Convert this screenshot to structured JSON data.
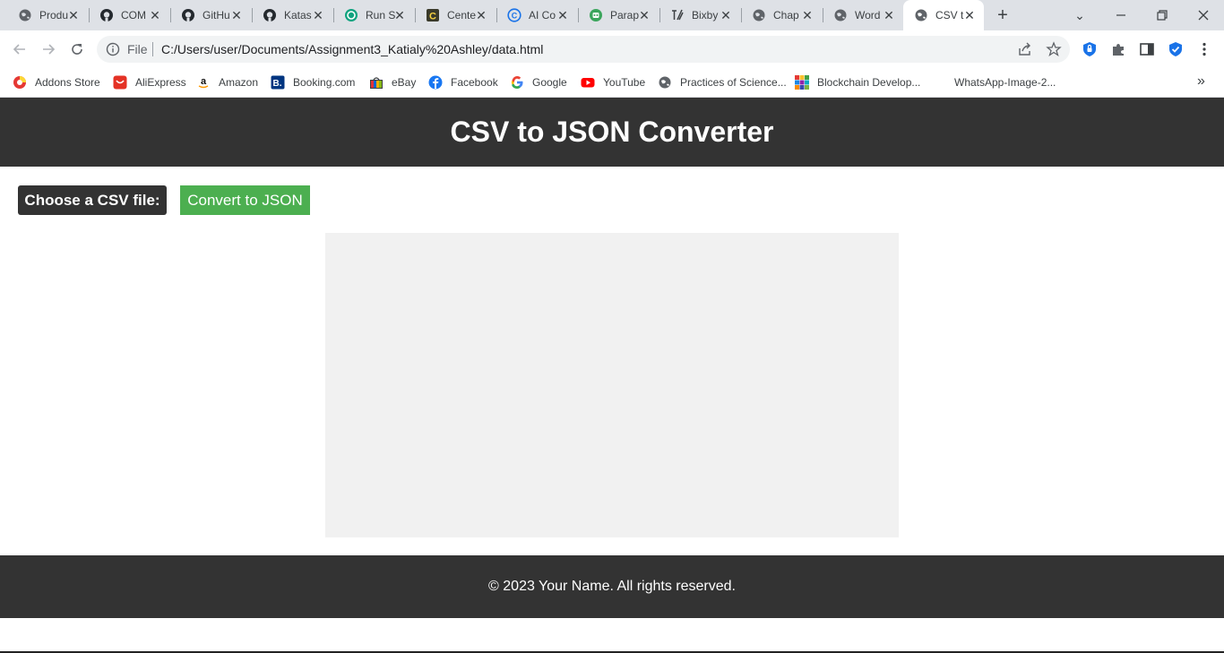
{
  "browser": {
    "tabs": [
      {
        "label": "Produ",
        "icon": "globe-icon"
      },
      {
        "label": "COM",
        "icon": "github-icon"
      },
      {
        "label": "GitHu",
        "icon": "github-icon"
      },
      {
        "label": "Katas",
        "icon": "github-icon"
      },
      {
        "label": "Run S",
        "icon": "openai-icon"
      },
      {
        "label": "Cente",
        "icon": "c-logo-icon"
      },
      {
        "label": "AI Co",
        "icon": "copyright-logo-icon"
      },
      {
        "label": "Parap",
        "icon": "robot-icon"
      },
      {
        "label": "Bixby",
        "icon": "quill-icon"
      },
      {
        "label": "Chap",
        "icon": "globe-icon"
      },
      {
        "label": "Word",
        "icon": "globe-icon"
      },
      {
        "label": "CSV t",
        "icon": "globe-icon",
        "active": true
      }
    ],
    "address": {
      "scheme_label": "File",
      "url": "C:/Users/user/Documents/Assignment3_Katialy%20Ashley/data.html"
    },
    "bookmarks": [
      {
        "label": "Addons Store",
        "icon": "addons-store-icon"
      },
      {
        "label": "AliExpress",
        "icon": "aliexpress-icon"
      },
      {
        "label": "Amazon",
        "icon": "amazon-icon"
      },
      {
        "label": "Booking.com",
        "icon": "booking-icon"
      },
      {
        "label": "eBay",
        "icon": "ebay-icon"
      },
      {
        "label": "Facebook",
        "icon": "facebook-icon"
      },
      {
        "label": "Google",
        "icon": "google-icon"
      },
      {
        "label": "YouTube",
        "icon": "youtube-icon"
      },
      {
        "label": "Practices of Science...",
        "icon": "globe-icon"
      },
      {
        "label": "Blockchain Develop...",
        "icon": "grid-icon"
      },
      {
        "label": "WhatsApp-Image-2...",
        "icon": ""
      }
    ]
  },
  "page": {
    "title": "CSV to JSON Converter",
    "file_label": "Choose a CSV file:",
    "convert_label": "Convert to JSON",
    "footer": "© 2023 Your Name. All rights reserved."
  },
  "colors": {
    "header_bg": "#333333",
    "button_green": "#4caf50",
    "output_bg": "#f1f1f1"
  }
}
